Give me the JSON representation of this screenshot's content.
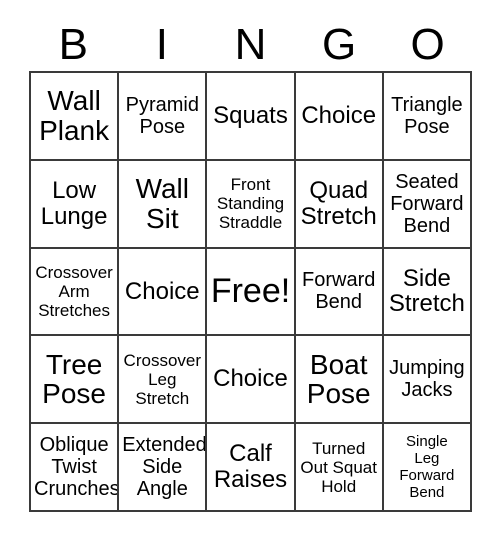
{
  "card": {
    "title_letters": [
      "B",
      "I",
      "N",
      "G",
      "O"
    ],
    "grid_size": "5x5",
    "ink_color": "#000000",
    "border_color": "#3a3a3a",
    "background_color": "#ffffff"
  },
  "rows": [
    {
      "cells": [
        {
          "label": "Wall\nPlank",
          "size": "xl"
        },
        {
          "label": "Pyramid\nPose",
          "size": "md"
        },
        {
          "label": "Squats",
          "size": "lg"
        },
        {
          "label": "Choice",
          "size": "lg"
        },
        {
          "label": "Triangle\nPose",
          "size": "md"
        }
      ]
    },
    {
      "cells": [
        {
          "label": "Low\nLunge",
          "size": "lg"
        },
        {
          "label": "Wall\nSit",
          "size": "xl"
        },
        {
          "label": "Front\nStanding\nStraddle",
          "size": "sm"
        },
        {
          "label": "Quad\nStretch",
          "size": "lg"
        },
        {
          "label": "Seated\nForward\nBend",
          "size": "md"
        }
      ]
    },
    {
      "cells": [
        {
          "label": "Crossover\nArm\nStretches",
          "size": "sm"
        },
        {
          "label": "Choice",
          "size": "lg"
        },
        {
          "label": "Free!",
          "size": "free",
          "is_free": true
        },
        {
          "label": "Forward\nBend",
          "size": "md"
        },
        {
          "label": "Side\nStretch",
          "size": "lg"
        }
      ]
    },
    {
      "cells": [
        {
          "label": "Tree\nPose",
          "size": "xl"
        },
        {
          "label": "Crossover\nLeg\nStretch",
          "size": "sm"
        },
        {
          "label": "Choice",
          "size": "lg"
        },
        {
          "label": "Boat\nPose",
          "size": "xl"
        },
        {
          "label": "Jumping\nJacks",
          "size": "md"
        }
      ]
    },
    {
      "cells": [
        {
          "label": "Oblique\nTwist\nCrunches",
          "size": "md"
        },
        {
          "label": "Extended\nSide\nAngle",
          "size": "md"
        },
        {
          "label": "Calf\nRaises",
          "size": "lg"
        },
        {
          "label": "Turned\nOut Squat\nHold",
          "size": "sm"
        },
        {
          "label": "Single\nLeg\nForward\nBend",
          "size": "xs"
        }
      ]
    }
  ]
}
